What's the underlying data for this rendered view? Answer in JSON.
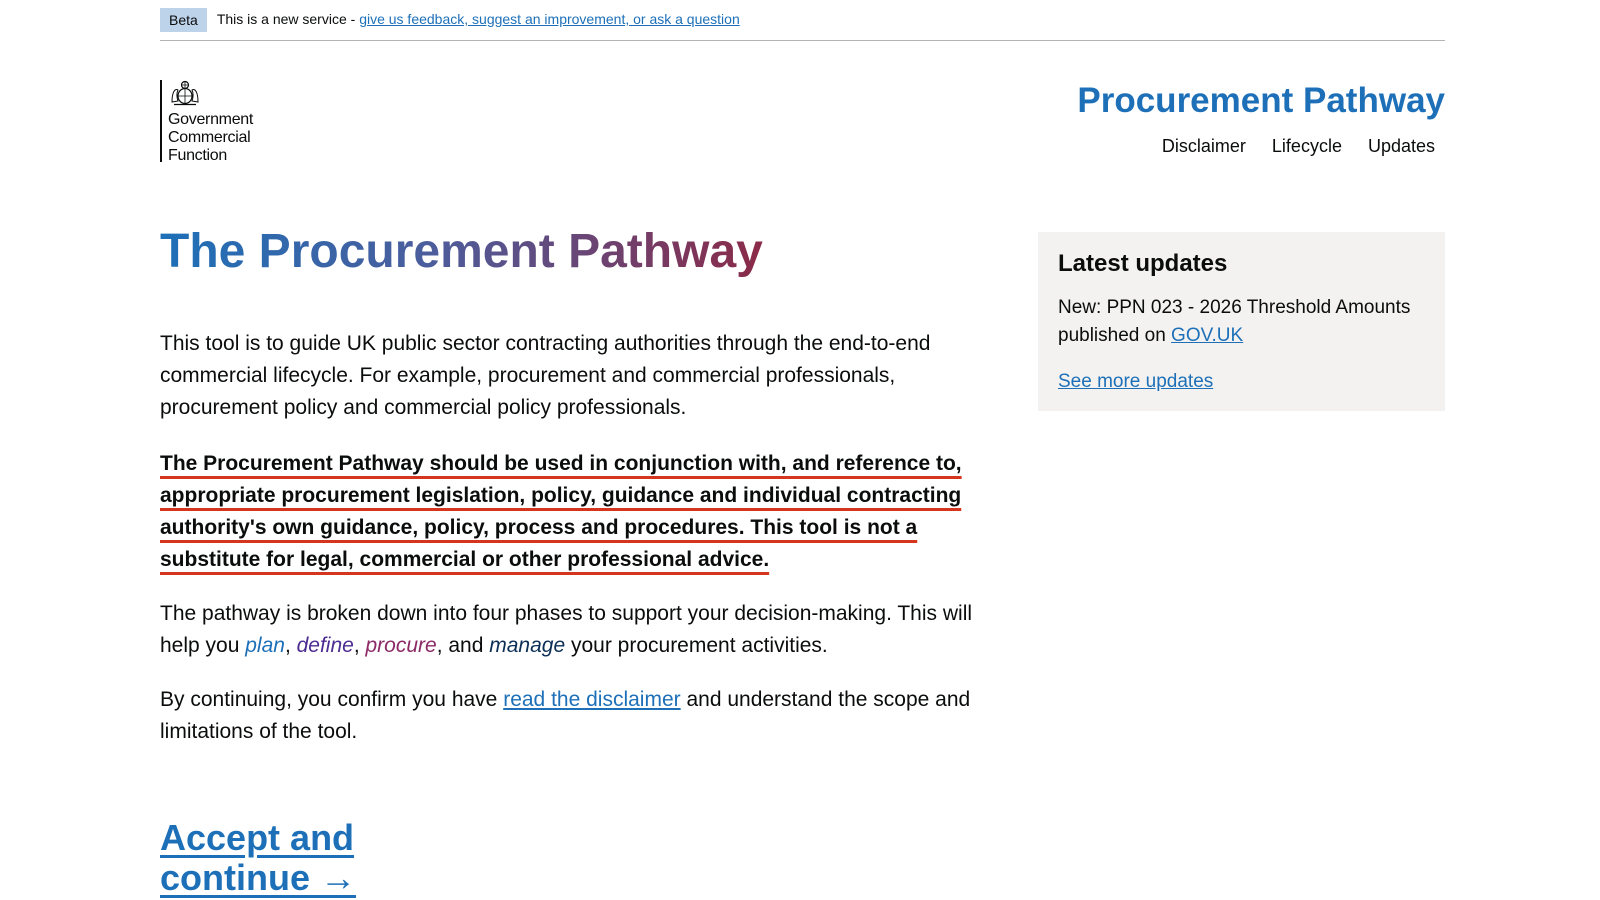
{
  "beta": {
    "tag": "Beta",
    "text": "This is a new service - ",
    "link": "give us feedback, suggest an improvement, or ask a question"
  },
  "header": {
    "logo_lines": [
      "Government",
      "Commercial",
      "Function"
    ],
    "service_name": "Procurement Pathway",
    "nav": [
      "Disclaimer",
      "Lifecycle",
      "Updates"
    ]
  },
  "main": {
    "title": "The Procurement Pathway",
    "intro": "This tool is to guide UK public sector contracting authorities through the end-to-end commercial lifecycle. For example, procurement and commercial professionals, procurement policy and commercial policy professionals.",
    "warning": "The Procurement Pathway should be used in conjunction with, and reference to, appropriate procurement legislation, policy, guidance and individual contracting authority's own guidance, policy, process and procedures. This tool is not a substitute for legal, commercial or other professional advice.",
    "phases": {
      "line1": "The pathway is broken down into four phases to support your decision-making. This will help you ",
      "plan": "plan",
      "sep1": ", ",
      "define": "define",
      "sep2": ", ",
      "procure": "procure",
      "sep3": ", and ",
      "manage": "manage",
      "end": " your procurement activities."
    },
    "confirm": {
      "before": "By continuing, you confirm you have ",
      "link": "read the disclaimer",
      "after": " and understand the scope and limitations of the tool."
    },
    "accept_label": "Accept and continue →"
  },
  "sidebar": {
    "title": "Latest updates",
    "update_text": "New: PPN 023 - 2026 Threshold Amounts published on ",
    "update_link": "GOV.UK",
    "more_link": "See more updates"
  },
  "colors": {
    "link": "#1d70b8",
    "warning_underline": "#d4351c",
    "sidebar_bg": "#f3f2f1",
    "beta_tag_bg": "#bcd3ea"
  }
}
